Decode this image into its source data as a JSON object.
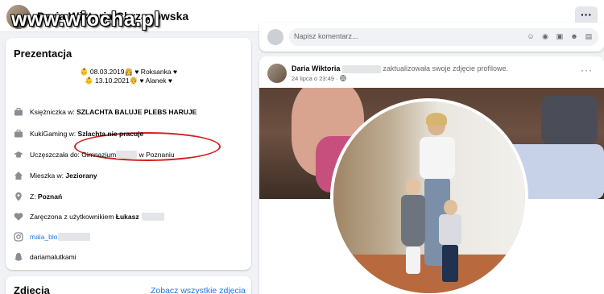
{
  "header": {
    "profile_name": "Daria Wiktoria Chrzanowska",
    "watermark": "www.wiocha.pl",
    "more_label": "···"
  },
  "intro": {
    "title": "Prezentacja",
    "bio_lines": [
      "👶 08.03.2019👸 ♥ Roksanka ♥",
      "👶 13.10.2021🤴 ♥ Alanek ♥"
    ],
    "items": [
      {
        "icon": "briefcase-icon",
        "prefix": "Księżniczka w: ",
        "value": "SZLACHTA BALUJE PLEBS HARUJE"
      },
      {
        "icon": "briefcase-icon",
        "prefix": "KukiGaming w: ",
        "value": "Szlachta nie pracuje"
      },
      {
        "icon": "graduation-cap-icon",
        "prefix": "Uczęszczała do: Gimnazjum",
        "suffix": " w Poznaniu"
      },
      {
        "icon": "home-icon",
        "prefix": "Mieszka w: ",
        "value": "Jeziorany"
      },
      {
        "icon": "location-pin-icon",
        "prefix": "Z: ",
        "value": "Poznań"
      },
      {
        "icon": "heart-icon",
        "prefix": "Zaręczona z użytkownikiem ",
        "value": "Łukasz"
      },
      {
        "icon": "instagram-icon",
        "link": "mala_blo"
      },
      {
        "icon": "snapchat-icon",
        "prefix": "dariamalutkami"
      }
    ]
  },
  "photos": {
    "title": "Zdjęcia",
    "see_all": "Zobacz wszystkie zdjęcia"
  },
  "comment_box": {
    "placeholder": "Napisz komentarz..."
  },
  "post": {
    "author": "Daria Wiktoria",
    "action": "zaktualizowała swoje zdjęcie profilowe.",
    "time": "24 lipca o 23:49 ·",
    "more": "···"
  },
  "colors": {
    "link": "#1877f2",
    "annotation": "#d21f1f",
    "background": "#f0f2f5"
  }
}
